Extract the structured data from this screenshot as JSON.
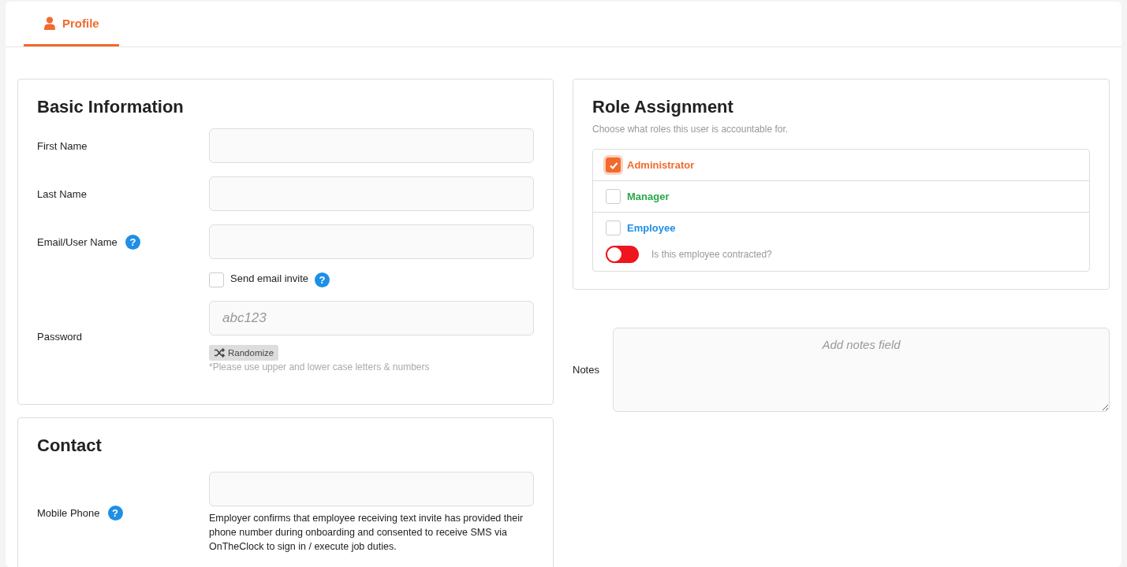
{
  "tabs": [
    {
      "label": "Profile",
      "selected": true
    }
  ],
  "basic_information": {
    "title": "Basic Information",
    "first_name": {
      "label": "First Name"
    },
    "last_name": {
      "label": "Last Name"
    },
    "email": {
      "label": "Email/User Name",
      "help": "?"
    },
    "send_invite": {
      "label": "Send email invite",
      "checked": false,
      "help": "?"
    },
    "password": {
      "label": "Password",
      "placeholder": "abc123",
      "button": "Randomize",
      "hint": "*Please use upper and lower case letters & numbers"
    }
  },
  "contact": {
    "title": "Contact",
    "mobile_phone": {
      "label": "Mobile Phone",
      "help": "?",
      "note": "Employer confirms that employee receiving text invite has provided their phone number during onboarding and consented to receive SMS via OnTheClock to sign in / execute job duties."
    }
  },
  "role_assignment": {
    "title": "Role Assignment",
    "subtitle": "Choose what roles this user is accountable for.",
    "roles": [
      {
        "label": "Administrator",
        "checked": true,
        "color": "#f26a2e"
      },
      {
        "label": "Manager",
        "checked": false,
        "color": "#2ba84a"
      },
      {
        "label": "Employee",
        "checked": false,
        "color": "#1e8fe6",
        "contracted": {
          "label": "Is this employee contracted?",
          "on": false
        }
      }
    ]
  },
  "notes": {
    "label": "Notes",
    "placeholder": "Add notes field"
  }
}
